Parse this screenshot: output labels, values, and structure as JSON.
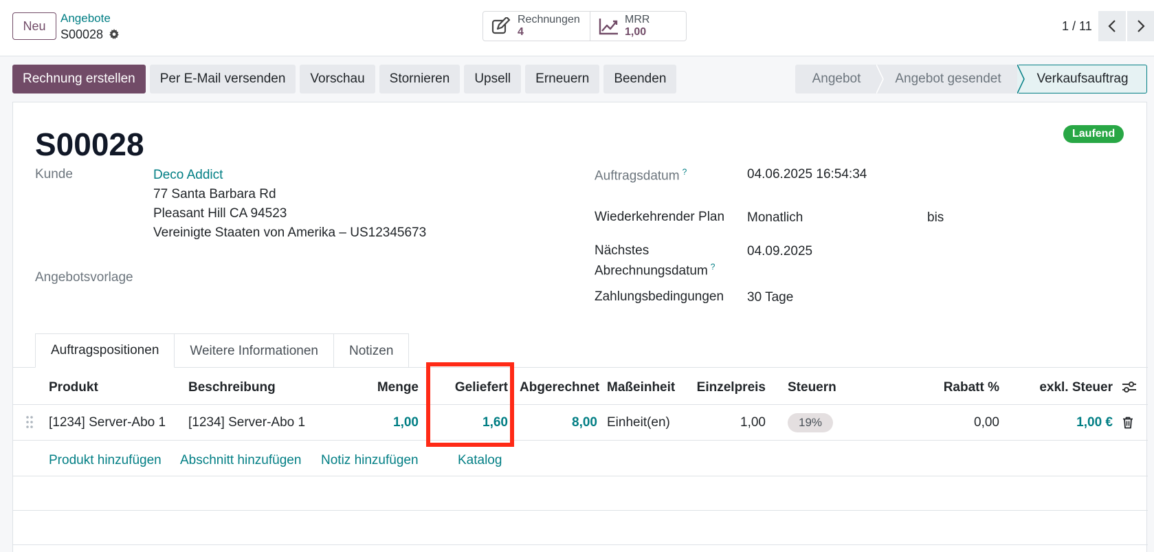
{
  "topbar": {
    "new_label": "Neu",
    "breadcrumb_parent": "Angebote",
    "breadcrumb_current": "S00028",
    "smart_buttons": [
      {
        "label": "Rechnungen",
        "value": "4",
        "icon": "edit-icon"
      },
      {
        "label": "MRR",
        "value": "1,00",
        "icon": "chart-line-icon"
      }
    ],
    "pager": "1 / 11"
  },
  "actions": {
    "create_invoice": "Rechnung erstellen",
    "send_email": "Per E-Mail versenden",
    "preview": "Vorschau",
    "cancel": "Stornieren",
    "upsell": "Upsell",
    "renew": "Erneuern",
    "close": "Beenden"
  },
  "statusbar": {
    "stages": [
      "Angebot",
      "Angebot gesendet",
      "Verkaufsauftrag"
    ],
    "active": "Verkaufsauftrag"
  },
  "record": {
    "title": "S00028",
    "state_badge": "Laufend",
    "customer_label": "Kunde",
    "customer_name": "Deco Addict",
    "address_line1": "77 Santa Barbara Rd",
    "address_line2": "Pleasant Hill CA 94523",
    "address_line3": "Vereinigte Staaten von Amerika – US12345673",
    "template_label": "Angebotsvorlage",
    "order_date_label": "Auftragsdatum",
    "order_date": "04.06.2025 16:54:34",
    "plan_label": "Wiederkehrender Plan",
    "plan_value": "Monatlich",
    "plan_until": "bis",
    "next_invoice_label_1": "Nächstes",
    "next_invoice_label_2": "Abrechnungsdatum",
    "next_invoice_date": "04.09.2025",
    "payment_terms_label": "Zahlungsbedingungen",
    "payment_terms": "30 Tage",
    "help_mark": "?"
  },
  "tabs": [
    "Auftragspositionen",
    "Weitere Informationen",
    "Notizen"
  ],
  "table": {
    "headers": {
      "product": "Produkt",
      "description": "Beschreibung",
      "quantity": "Menge",
      "delivered": "Geliefert",
      "invoiced": "Abgerechnet",
      "uom": "Maßeinheit",
      "unit_price": "Einzelpreis",
      "taxes": "Steuern",
      "discount": "Rabatt %",
      "subtotal": "exkl. Steuer"
    },
    "rows": [
      {
        "product": "[1234] Server-Abo 1",
        "description": "[1234] Server-Abo 1",
        "quantity": "1,00",
        "delivered": "1,60",
        "invoiced": "8,00",
        "uom": "Einheit(en)",
        "unit_price": "1,00",
        "taxes": "19%",
        "discount": "0,00",
        "subtotal": "1,00 €"
      }
    ],
    "add_product": "Produkt hinzufügen",
    "add_section": "Abschnitt hinzufügen",
    "add_note": "Notiz hinzufügen",
    "catalog": "Katalog"
  },
  "colors": {
    "primary": "#714b67",
    "link": "#017e84",
    "highlight": "#ff2a16",
    "success": "#28a745"
  }
}
